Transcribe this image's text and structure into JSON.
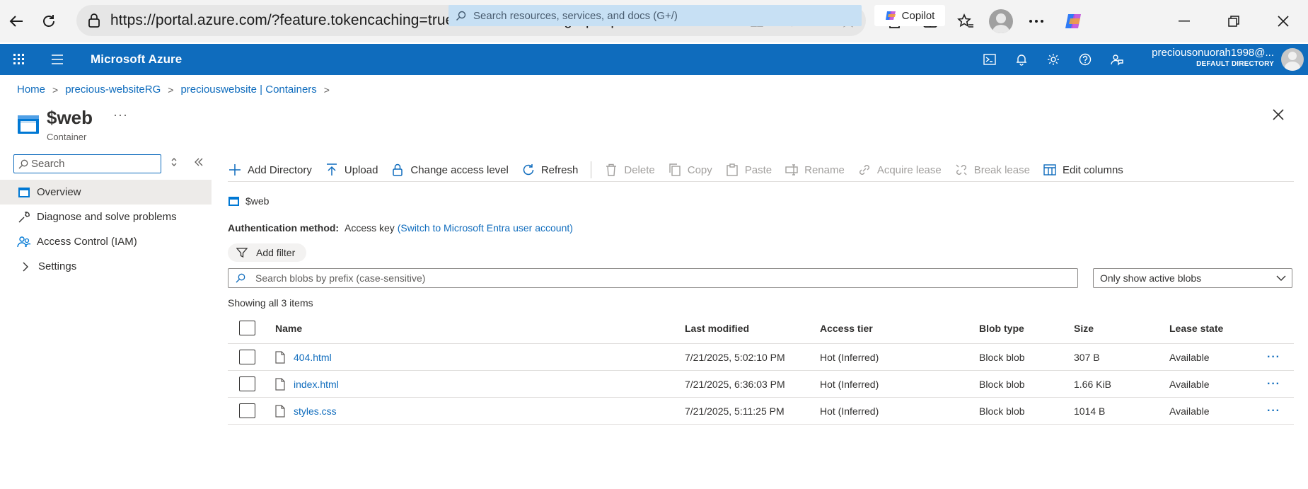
{
  "browser": {
    "url": "https://portal.azure.com/?feature.tokencaching=true&feature.internalgraphapiversion=true..."
  },
  "azure": {
    "brand": "Microsoft Azure",
    "search_placeholder": "Search resources, services, and docs (G+/)",
    "copilot_label": "Copilot",
    "user_name": "preciousonuorah1998@...",
    "user_directory": "DEFAULT DIRECTORY"
  },
  "breadcrumb": [
    "Home",
    "precious-websiteRG",
    "preciouswebsite | Containers"
  ],
  "header": {
    "title": "$web",
    "subtitle": "Container",
    "more": "···"
  },
  "left_nav": {
    "search_placeholder": "Search",
    "items": [
      {
        "label": "Overview",
        "icon": "container-icon"
      },
      {
        "label": "Diagnose and solve problems",
        "icon": "wrench-icon"
      },
      {
        "label": "Access Control (IAM)",
        "icon": "people-icon"
      },
      {
        "label": "Settings",
        "icon": "chevron-right-icon"
      }
    ]
  },
  "toolbar": {
    "add_directory": "Add Directory",
    "upload": "Upload",
    "change_access": "Change access level",
    "refresh": "Refresh",
    "delete": "Delete",
    "copy": "Copy",
    "paste": "Paste",
    "rename": "Rename",
    "acquire_lease": "Acquire lease",
    "break_lease": "Break lease",
    "edit_columns": "Edit columns"
  },
  "content": {
    "path": "$web",
    "auth_label": "Authentication method:",
    "auth_value": "Access key",
    "auth_link": "(Switch to Microsoft Entra user account)",
    "add_filter": "Add filter",
    "blob_search_placeholder": "Search blobs by prefix (case-sensitive)",
    "active_filter": "Only show active blobs",
    "showing": "Showing all 3 items"
  },
  "table": {
    "columns": [
      "Name",
      "Last modified",
      "Access tier",
      "Blob type",
      "Size",
      "Lease state"
    ],
    "rows": [
      {
        "name": "404.html",
        "modified": "7/21/2025, 5:02:10 PM",
        "tier": "Hot (Inferred)",
        "type": "Block blob",
        "size": "307 B",
        "lease": "Available"
      },
      {
        "name": "index.html",
        "modified": "7/21/2025, 6:36:03 PM",
        "tier": "Hot (Inferred)",
        "type": "Block blob",
        "size": "1.66 KiB",
        "lease": "Available"
      },
      {
        "name": "styles.css",
        "modified": "7/21/2025, 5:11:25 PM",
        "tier": "Hot (Inferred)",
        "type": "Block blob",
        "size": "1014 B",
        "lease": "Available"
      }
    ],
    "row_more": "···"
  },
  "colors": {
    "azure_blue": "#0f6cbd",
    "link": "#0f6cbd",
    "disabled": "#a19f9d"
  }
}
